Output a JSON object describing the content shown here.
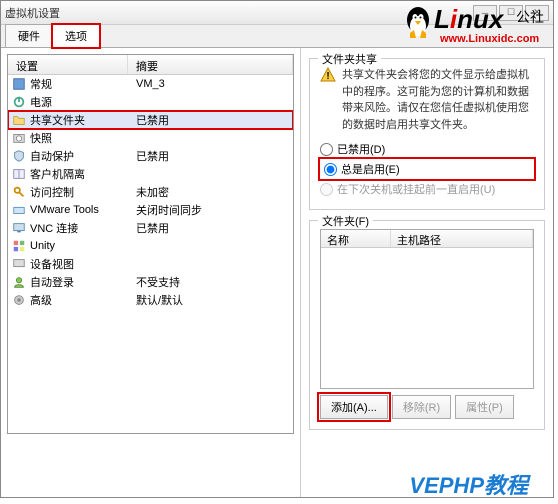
{
  "window": {
    "title": "虚拟机设置"
  },
  "tabs": {
    "hardware": "硬件",
    "options": "选项"
  },
  "table": {
    "col_device": "设置",
    "col_summary": "摘要",
    "rows": [
      {
        "label": "常规",
        "summary": "VM_3"
      },
      {
        "label": "电源",
        "summary": ""
      },
      {
        "label": "共享文件夹",
        "summary": "已禁用"
      },
      {
        "label": "快照",
        "summary": ""
      },
      {
        "label": "自动保护",
        "summary": "已禁用"
      },
      {
        "label": "客户机隔离",
        "summary": ""
      },
      {
        "label": "访问控制",
        "summary": "未加密"
      },
      {
        "label": "VMware Tools",
        "summary": "关闭时间同步"
      },
      {
        "label": "VNC 连接",
        "summary": "已禁用"
      },
      {
        "label": "Unity",
        "summary": ""
      },
      {
        "label": "设备视图",
        "summary": ""
      },
      {
        "label": "自动登录",
        "summary": "不受支持"
      },
      {
        "label": "高级",
        "summary": "默认/默认"
      }
    ]
  },
  "share": {
    "group_title": "文件夹共享",
    "warning": "共享文件夹会将您的文件显示给虚拟机中的程序。这可能为您的计算机和数据带来风险。请仅在您信任虚拟机使用您的数据时启用共享文件夹。",
    "opt_disabled": "已禁用(D)",
    "opt_always": "总是启用(E)",
    "opt_next": "在下次关机或挂起前一直启用(U)"
  },
  "folders": {
    "group_title": "文件夹(F)",
    "col_name": "名称",
    "col_path": "主机路径",
    "btn_add": "添加(A)...",
    "btn_remove": "移除(R)",
    "btn_props": "属性(P)"
  },
  "logo": {
    "text_black": "L",
    "text_red": "i",
    "text_rest": "nux",
    "text_suffix": "公社",
    "url": "www.Linuxidc.com"
  },
  "brand": "VEPHP教程"
}
